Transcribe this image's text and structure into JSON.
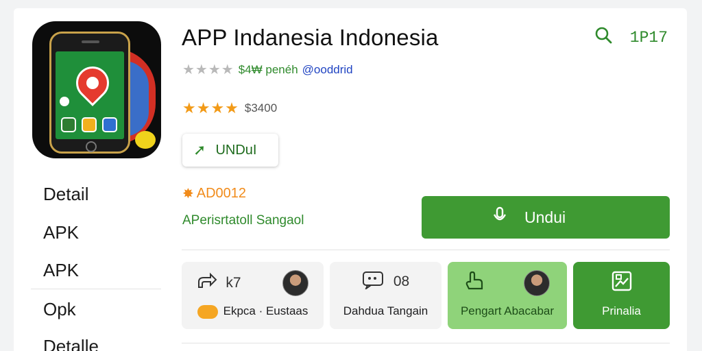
{
  "app": {
    "title": "APP Indanesia Indonesia",
    "meta_price": "$4₩ penéh",
    "meta_dev": "@ooddrid",
    "rating_text": "$3400",
    "small_button_label": "UNDuI",
    "badge_text": "AD0012",
    "spec_text": "APerisrtatoll Sangaol",
    "big_button_label": "Undui"
  },
  "top": {
    "search_icon": "search-icon",
    "code": "1P17"
  },
  "sidebar": {
    "items": [
      {
        "label": "Detail"
      },
      {
        "label": "APK"
      },
      {
        "label": "APK"
      },
      {
        "label": "Opk"
      },
      {
        "label": "Detalle"
      }
    ]
  },
  "tiles": [
    {
      "count": "k7",
      "label": "Ekpca · Eustaas"
    },
    {
      "count": "08",
      "label": "Dahdua Tangain"
    },
    {
      "count": "",
      "label": "Pengart Abacabar"
    },
    {
      "count": "",
      "label": "Prinalia"
    }
  ],
  "colors": {
    "accent_green": "#3f9a33",
    "light_green": "#8fd37a",
    "star_orange": "#f29a17",
    "link_blue": "#2044c2"
  }
}
